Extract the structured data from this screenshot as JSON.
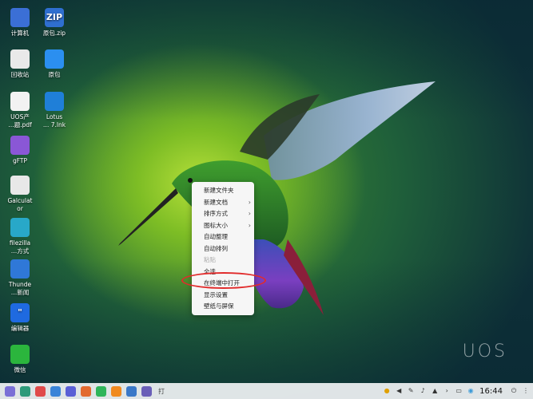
{
  "desktop_icons": [
    {
      "label": "计算机",
      "icon": "computer-icon",
      "color": "#3b6fd6"
    },
    {
      "label": "原包.zip",
      "icon": "zip-file-icon",
      "color": "#2f6fd0",
      "glyph": "ZIP"
    },
    {
      "label": "回收站",
      "icon": "trash-icon",
      "color": "#e9e9e9"
    },
    {
      "label": "原包",
      "icon": "folder-icon",
      "color": "#2b8ff0"
    },
    {
      "label": "UOS产\n…题.pdf",
      "icon": "pdf-file-icon",
      "color": "#f2f2f2"
    },
    {
      "label": "Lotus\n… 7.lnk",
      "icon": "lotus-shortcut-icon",
      "color": "#1f7fd8"
    },
    {
      "label": "gFTP",
      "icon": "gftp-icon",
      "color": "#8a57d6"
    },
    {
      "label": "Galculat\nor",
      "icon": "calculator-icon",
      "color": "#e8e8e8"
    },
    {
      "label": "filezilla\n…方式",
      "icon": "filezilla-icon",
      "color": "#28a8c8"
    },
    {
      "label": "Thunde\n…新闻",
      "icon": "thunderbird-icon",
      "color": "#2f78d8"
    },
    {
      "label": "编辑器",
      "icon": "editor-icon",
      "color": "#1f6ae0",
      "glyph": "\""
    },
    {
      "label": "微信",
      "icon": "wechat-icon",
      "color": "#2bb53d"
    }
  ],
  "context_menu": {
    "items": [
      {
        "label": "新建文件夹",
        "has_submenu": false,
        "disabled": false
      },
      {
        "label": "新建文档",
        "has_submenu": true,
        "disabled": false
      },
      {
        "label": "排序方式",
        "has_submenu": true,
        "disabled": false
      },
      {
        "label": "图标大小",
        "has_submenu": true,
        "disabled": false
      },
      {
        "label": "自动整理",
        "has_submenu": false,
        "disabled": false
      },
      {
        "label": "自动排列",
        "has_submenu": false,
        "disabled": false
      },
      {
        "label": "粘贴",
        "has_submenu": false,
        "disabled": true
      },
      {
        "label": "全选",
        "has_submenu": false,
        "disabled": false
      },
      {
        "label": "在终端中打开",
        "has_submenu": false,
        "disabled": false,
        "highlighted": true
      },
      {
        "label": "显示设置",
        "has_submenu": false,
        "disabled": false
      },
      {
        "label": "壁纸与屏保",
        "has_submenu": false,
        "disabled": false
      }
    ],
    "submenu_arrow": "›"
  },
  "wallpaper": {
    "brand_text": "UOS"
  },
  "taskbar": {
    "apps": [
      {
        "icon": "launcher-icon",
        "color": "#7a6fd6"
      },
      {
        "icon": "multitask-icon",
        "color": "#2e9a7a"
      },
      {
        "icon": "app-store-icon",
        "color": "#e04a4a"
      },
      {
        "icon": "file-manager-icon",
        "color": "#3a84d8"
      },
      {
        "icon": "browser-icon",
        "color": "#5a5fd6"
      },
      {
        "icon": "image-viewer-icon",
        "color": "#e26a2f"
      },
      {
        "icon": "music-icon",
        "color": "#2fb55a"
      },
      {
        "icon": "archive-icon",
        "color": "#f08a1f"
      },
      {
        "icon": "document-viewer-icon",
        "color": "#3a78c8"
      },
      {
        "icon": "settings-icon",
        "color": "#6a5fb8"
      }
    ],
    "taskbar_text_badge": "打",
    "clock": "16:44"
  }
}
